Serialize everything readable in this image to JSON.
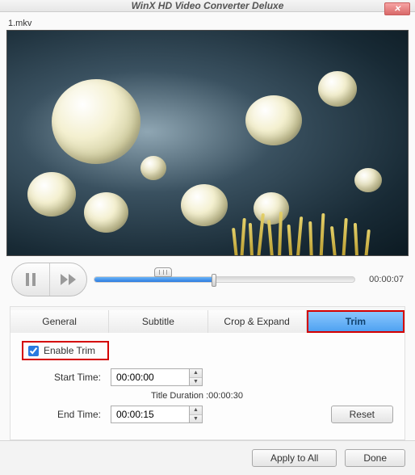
{
  "window": {
    "title": "WinX HD Video Converter Deluxe"
  },
  "file": {
    "name": "1.mkv"
  },
  "playback": {
    "current_time": "00:00:07"
  },
  "tabs": {
    "general": "General",
    "subtitle": "Subtitle",
    "crop": "Crop & Expand",
    "trim": "Trim",
    "active": "trim"
  },
  "trim": {
    "enable_label": "Enable Trim",
    "enabled": true,
    "start_label": "Start Time:",
    "start_value": "00:00:00",
    "end_label": "End Time:",
    "end_value": "00:00:15",
    "duration_label": "Title Duration :00:00:30",
    "reset_label": "Reset"
  },
  "footer": {
    "apply_all": "Apply to All",
    "done": "Done"
  }
}
